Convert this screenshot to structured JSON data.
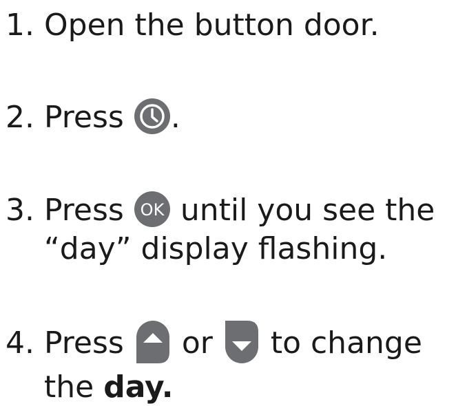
{
  "steps": [
    {
      "number": "1.",
      "text": "Open the button door."
    },
    {
      "number": "2.",
      "before": "Press",
      "after": ".",
      "icon": "clock-icon"
    },
    {
      "number": "3.",
      "before": "Press",
      "icon_label": "OK",
      "after_line1": "until you see the",
      "line2": "“day” display flashing."
    },
    {
      "number": "4.",
      "before": "Press",
      "icon_up": "up-arrow-button-icon",
      "connector": "or",
      "icon_down": "down-arrow-button-icon",
      "after_line1": "to change",
      "line2_before": "the",
      "line2_bold": "day."
    }
  ],
  "colors": {
    "text": "#1a1a1a",
    "icon_fill": "#6d6e71",
    "icon_glyph": "#ffffff"
  }
}
